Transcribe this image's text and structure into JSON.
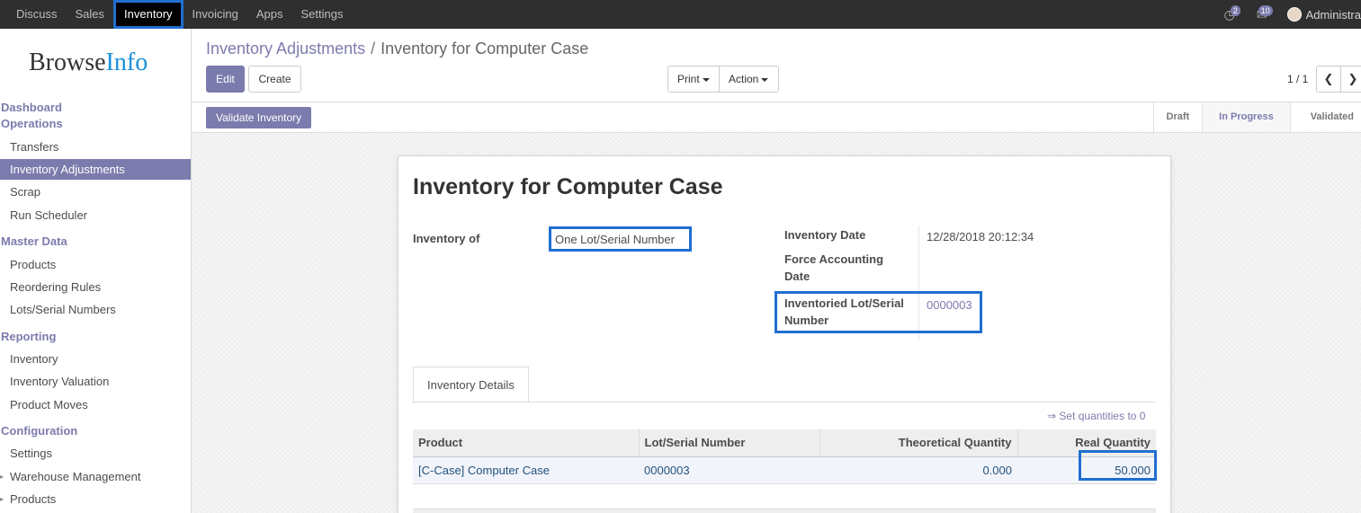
{
  "topbar": {
    "menu": [
      "Discuss",
      "Sales",
      "Inventory",
      "Invoicing",
      "Apps",
      "Settings"
    ],
    "active": "Inventory",
    "activity_count": "2",
    "messages_count": "10",
    "user": "Administra"
  },
  "sidebar": {
    "logo_part1": "Browse",
    "logo_part2": "Info",
    "sections": {
      "dashboard": "Dashboard",
      "operations": "Operations",
      "master_data": "Master Data",
      "reporting": "Reporting",
      "configuration": "Configuration"
    },
    "items": {
      "transfers": "Transfers",
      "inventory_adjustments": "Inventory Adjustments",
      "scrap": "Scrap",
      "run_scheduler": "Run Scheduler",
      "products": "Products",
      "reordering_rules": "Reordering Rules",
      "lots_serial": "Lots/Serial Numbers",
      "inventory": "Inventory",
      "inventory_valuation": "Inventory Valuation",
      "product_moves": "Product Moves",
      "settings": "Settings",
      "warehouse_management": "Warehouse Management",
      "config_products": "Products"
    }
  },
  "breadcrumb": {
    "parent": "Inventory Adjustments",
    "separator": "/",
    "current": "Inventory for Computer Case"
  },
  "buttons": {
    "edit": "Edit",
    "create": "Create",
    "print": "Print",
    "action": "Action",
    "validate": "Validate Inventory"
  },
  "pager": {
    "value": "1 / 1",
    "prev_icon": "chevron-left-icon",
    "next_icon": "chevron-right-icon"
  },
  "stages": [
    "Draft",
    "In Progress",
    "Validated"
  ],
  "current_stage": "In Progress",
  "form": {
    "title": "Inventory for Computer Case",
    "inventory_of_label": "Inventory of",
    "inventory_of_value": "One Lot/Serial Number",
    "inventory_date_label": "Inventory Date",
    "inventory_date_value": "12/28/2018 20:12:34",
    "force_accounting_label_1": "Force Accounting",
    "force_accounting_label_2": "Date",
    "lot_label_1": "Inventoried Lot/Serial",
    "lot_label_2": "Number",
    "lot_value": "0000003"
  },
  "tab": {
    "label": "Inventory Details"
  },
  "set_quantities": "⇒ Set quantities to 0",
  "table": {
    "headers": [
      "Product",
      "Lot/Serial Number",
      "Theoretical Quantity",
      "Real Quantity"
    ],
    "rows": [
      [
        "[C-Case] Computer Case",
        "0000003",
        "0.000",
        "50.000"
      ]
    ]
  },
  "colors": {
    "accent": "#7c7bad",
    "highlight_box": "#1f6fcf",
    "topbar": "#2f2f2f"
  }
}
